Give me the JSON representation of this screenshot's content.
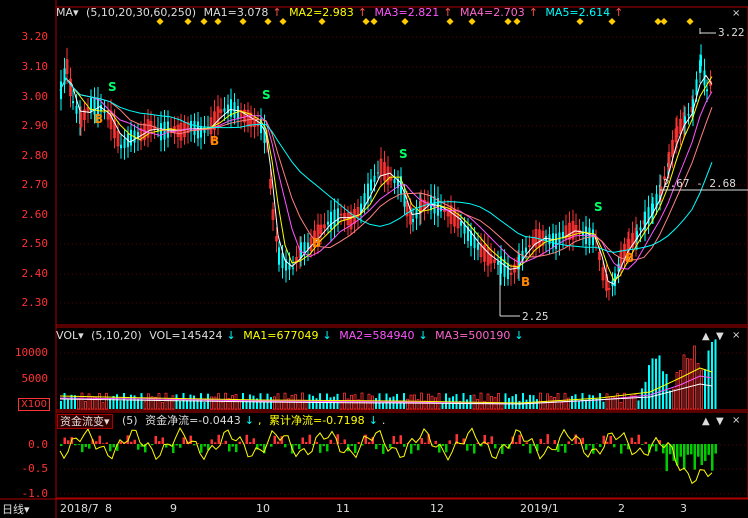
{
  "price_panel": {
    "indicator": "MA▾",
    "params": "(5,10,20,30,60,250)",
    "ma1": "MA1=3.078",
    "ma2": "MA2=2.983",
    "ma3": "MA3=2.821",
    "ma4": "MA4=2.703",
    "ma5": "MA5=2.614",
    "arrow": "↑",
    "y_ticks": [
      "3.20",
      "3.10",
      "3.00",
      "2.90",
      "2.80",
      "2.70",
      "2.60",
      "2.50",
      "2.40",
      "2.30"
    ],
    "high_label": "3.22",
    "low_label": "2.25",
    "line_label": "2.67 - 2.68",
    "buy": "B",
    "sell": "S"
  },
  "volume_panel": {
    "indicator": "VOL▾",
    "params": "(5,10,20)",
    "vol": "VOL=145424",
    "ma1": "MA1=677049",
    "ma2": "MA2=584940",
    "ma3": "MA3=500190",
    "down": "↓",
    "y_ticks": [
      "10000",
      "5000"
    ],
    "unit": "X100"
  },
  "fund_panel": {
    "button": "资金流变▾",
    "params": "(5)",
    "net": "资金净流=-0.0443",
    "cum": "累计净流=-0.7198",
    "down": "↓",
    "comma": ",",
    "dot": ".",
    "y_ticks": [
      "0.0",
      "-0.5",
      "-1.0"
    ]
  },
  "x_axis": {
    "mode": "日线",
    "mode_arrow": "▾",
    "labels": [
      "2018/7",
      "8",
      "9",
      "10",
      "11",
      "12",
      "2019/1",
      "2",
      "3"
    ]
  },
  "corner_icons": [
    "▲",
    "▼",
    "×"
  ],
  "colors": {
    "up": "#ff3333",
    "down": "#00ffff",
    "ma1": "#ffffff",
    "ma2": "#ffff00",
    "ma3": "#ff55ff",
    "ma4": "#ff8080",
    "ma5": "#00ffff",
    "grid": "#800000"
  }
}
